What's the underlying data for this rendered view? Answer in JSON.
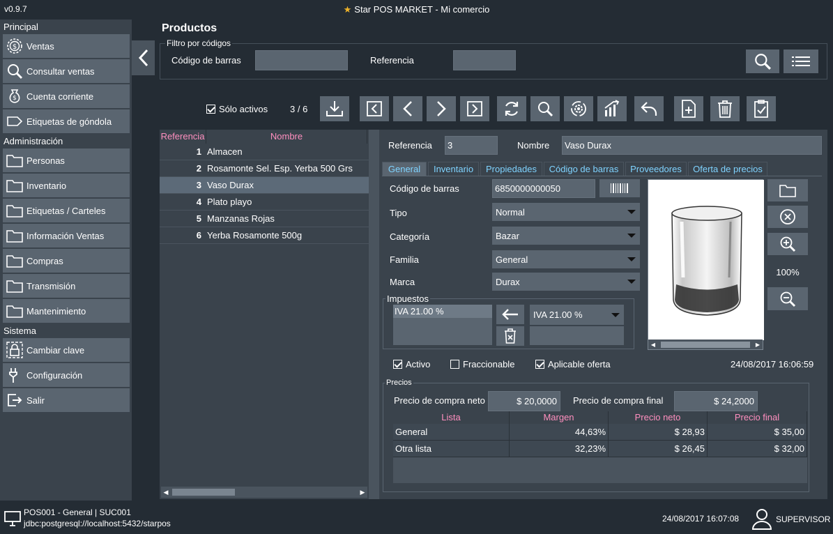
{
  "app": {
    "version": "v0.9.7",
    "title": "Star POS MARKET - Mi comercio"
  },
  "sidebar": {
    "sections": [
      {
        "title": "Principal",
        "items": [
          {
            "label": "Ventas",
            "icon": "dollar-coin-icon"
          },
          {
            "label": "Consultar ventas",
            "icon": "search-icon"
          },
          {
            "label": "Cuenta corriente",
            "icon": "money-bag-icon"
          },
          {
            "label": "Etiquetas de góndola",
            "icon": "tag-icon"
          }
        ]
      },
      {
        "title": "Administración",
        "items": [
          {
            "label": "Personas",
            "icon": "folder-icon"
          },
          {
            "label": "Inventario",
            "icon": "folder-icon"
          },
          {
            "label": "Etiquetas / Carteles",
            "icon": "folder-icon"
          },
          {
            "label": "Información Ventas",
            "icon": "folder-icon"
          },
          {
            "label": "Compras",
            "icon": "folder-icon"
          },
          {
            "label": "Transmisión",
            "icon": "folder-icon"
          },
          {
            "label": "Mantenimiento",
            "icon": "folder-icon"
          }
        ]
      },
      {
        "title": "Sistema",
        "items": [
          {
            "label": "Cambiar clave",
            "icon": "lock-icon"
          },
          {
            "label": "Configuración",
            "icon": "wrench-icon"
          },
          {
            "label": "Salir",
            "icon": "exit-icon"
          }
        ]
      }
    ]
  },
  "page": {
    "title": "Productos",
    "filter": {
      "legend": "Filtro por códigos",
      "barcode_label": "Código de barras",
      "barcode_value": "",
      "reference_label": "Referencia",
      "reference_value": ""
    },
    "toolbar": {
      "only_active_label": "Sólo activos",
      "only_active_checked": true,
      "record_position": "3 / 6"
    }
  },
  "product_list": {
    "columns": [
      "Referencia",
      "Nombre"
    ],
    "rows": [
      {
        "ref": "1",
        "name": "Almacen"
      },
      {
        "ref": "2",
        "name": "Rosamonte Sel. Esp. Yerba 500 Grs"
      },
      {
        "ref": "3",
        "name": "Vaso Durax"
      },
      {
        "ref": "4",
        "name": "Plato playo"
      },
      {
        "ref": "5",
        "name": "Manzanas Rojas"
      },
      {
        "ref": "6",
        "name": "Yerba Rosamonte 500g"
      }
    ],
    "selected_ref": "3"
  },
  "detail": {
    "reference_label": "Referencia",
    "reference_value": "3",
    "name_label": "Nombre",
    "name_value": "Vaso Durax",
    "tabs": [
      "General",
      "Inventario",
      "Propiedades",
      "Código de barras",
      "Proveedores",
      "Oferta de precios"
    ],
    "active_tab": "General",
    "barcode_label": "Código de barras",
    "barcode_value": "6850000000050",
    "type_label": "Tipo",
    "type_value": "Normal",
    "category_label": "Categoría",
    "category_value": "Bazar",
    "family_label": "Familia",
    "family_value": "General",
    "brand_label": "Marca",
    "brand_value": "Durax",
    "taxes_legend": "Impuestos",
    "taxes_list": [
      "IVA 21.00 %"
    ],
    "tax_select_value": "IVA 21.00 %",
    "zoom_level": "100%",
    "active_label": "Activo",
    "active_checked": true,
    "fractional_label": "Fraccionable",
    "fractional_checked": false,
    "offer_label": "Aplicable oferta",
    "offer_checked": true,
    "updated_at": "24/08/2017 16:06:59",
    "prices": {
      "legend": "Precios",
      "net_cost_label": "Precio de compra neto",
      "net_cost_value": "$ 20,0000",
      "final_cost_label": "Precio de compra final",
      "final_cost_value": "$ 24,2000",
      "columns": [
        "Lista",
        "Margen",
        "Precio neto",
        "Precio final"
      ],
      "rows": [
        {
          "lista": "General",
          "margen": "44,63%",
          "neto": "$ 28,93",
          "final": "$ 35,00"
        },
        {
          "lista": "Otra lista",
          "margen": "32,23%",
          "neto": "$ 26,45",
          "final": "$ 32,00"
        }
      ]
    }
  },
  "status": {
    "terminal": "POS001 - General | SUC001",
    "connection": "jdbc:postgresql://localhost:5432/starpos",
    "datetime": "24/08/2017 16:07:08",
    "user": "SUPERVISOR"
  },
  "colors": {
    "background": "#242c34",
    "panel": "#3a434c",
    "button": "#5a6570",
    "header_pink": "#ff8fbf",
    "tab_blue": "#7fd3ff",
    "star": "#f0b429"
  }
}
